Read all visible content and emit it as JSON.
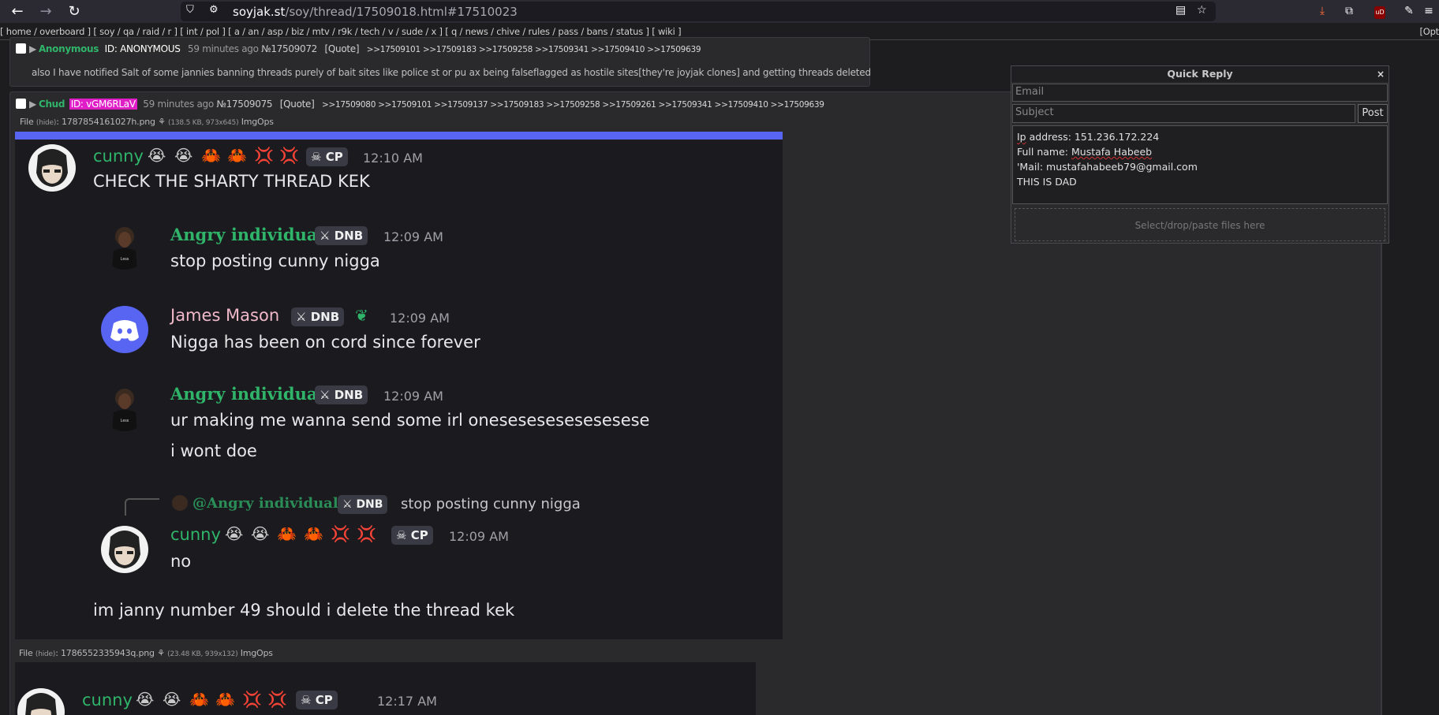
{
  "browser": {
    "url_host": "soyjak.st",
    "url_path": "/soy/thread/17509018.html#17510023"
  },
  "boardnav": {
    "text": "[ home / overboard ] [ soy / qa / raid / r ] [ int / pol ] [ a / an / asp / biz / mtv / r9k / tech / v / sude / x ] [ q / news / chive / rules / pass / bans / status ] [ wiki ]",
    "options": "[Opt"
  },
  "post1": {
    "name": "Anonymous",
    "id": "ID: ANONYMOUS",
    "time": "59 minutes ago",
    "no": "№17509072",
    "quote": "[Quote]",
    "backlinks": ">>17509101  >>17509183  >>17509258  >>17509341  >>17509410  >>17509639",
    "body": "also I have notified Salt of some jannies banning threads purely of bait sites like police st or pu ax being falseflagged as hostile sites[they're joyjak clones] and getting threads deleted"
  },
  "post2": {
    "name": "Chud",
    "id": "ID: vGM6RLaV",
    "time": "59 minutes ago",
    "no": "№17509075",
    "quote": "[Quote]",
    "backlinks": ">>17509080  >>17509101  >>17509137  >>17509183  >>17509258  >>17509261  >>17509341  >>17509410  >>17509639",
    "file1_label": "File",
    "file1_hide": "(hide)",
    "file1_name": ": 1787854161027h.png",
    "file1_meta": "(138.5 KB, 973x645)",
    "file1_imgops": "ImgOps",
    "file2_label": "File",
    "file2_hide": "(hide)",
    "file2_name": ": 1786552335943q.png",
    "file2_meta": "(23.48 KB, 939x132)",
    "file2_imgops": "ImgOps"
  },
  "discord1": {
    "m1_name": "cunny",
    "m1_tag": "CP",
    "m1_time": "12:10 AM",
    "m1_text": "CHECK THE SHARTY THREAD KEK",
    "m2_name": "Angry individual",
    "m2_tag": "DNB",
    "m2_time": "12:09 AM",
    "m2_text": "stop posting cunny nigga",
    "m3_name": "James Mason",
    "m3_tag": "DNB",
    "m3_time": "12:09 AM",
    "m3_text": "Nigga has been on cord since forever",
    "m4_name": "Angry individual",
    "m4_tag": "DNB",
    "m4_time": "12:09 AM",
    "m4_text1": "ur making me wanna send some irl onesesesesesesesese",
    "m4_text2": "i wont doe",
    "reply_name": "@Angry individual",
    "reply_tag": "DNB",
    "reply_text": "stop posting cunny nigga",
    "m5_name": "cunny",
    "m5_tag": "CP",
    "m5_time": "12:09 AM",
    "m5_text": "no",
    "m6_text": "im janny number 49 should i delete the thread kek"
  },
  "discord2": {
    "m1_name": "cunny",
    "m1_tag": "CP",
    "m1_time": "12:17 AM"
  },
  "quick_reply": {
    "title": "Quick Reply",
    "close": "×",
    "email_placeholder": "Email",
    "subject_placeholder": "Subject",
    "post_label": "Post",
    "body_line1_a": "Ip",
    "body_line1_b": " address: 151.236.172.224",
    "body_line2_a": "Full name: ",
    "body_line2_b": "Mustafa Habeeb",
    "body_line3": "'Mail: mustafahabeeb79@gmail.com",
    "body_line4": "THIS IS DAD",
    "drop_label": "Select/drop/paste files here"
  }
}
